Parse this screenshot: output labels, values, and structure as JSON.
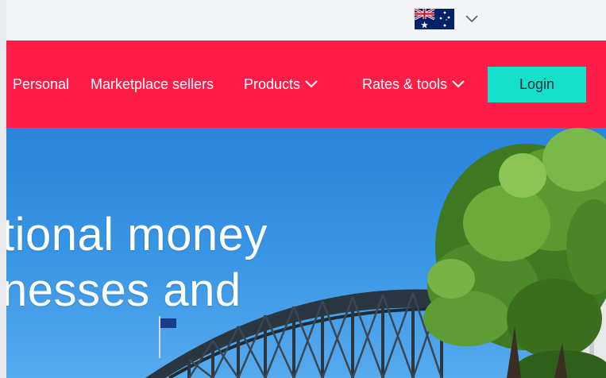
{
  "topbar": {
    "country": {
      "icon": "australia-flag-icon",
      "dropdown_icon": "chevron-down-icon"
    }
  },
  "nav": {
    "items": [
      {
        "label": "Personal"
      },
      {
        "label": "Marketplace sellers"
      },
      {
        "label": "Products",
        "has_dropdown": true
      },
      {
        "label": "Rates & tools",
        "has_dropdown": true
      }
    ],
    "login_label": "Login"
  },
  "hero": {
    "line1": "tional money",
    "line2": "nesses and"
  },
  "colors": {
    "nav_background": "#ff1d48",
    "login_button": "#14e0cc",
    "topbar_background": "#f2f4f7",
    "sky": "#2a84da"
  }
}
